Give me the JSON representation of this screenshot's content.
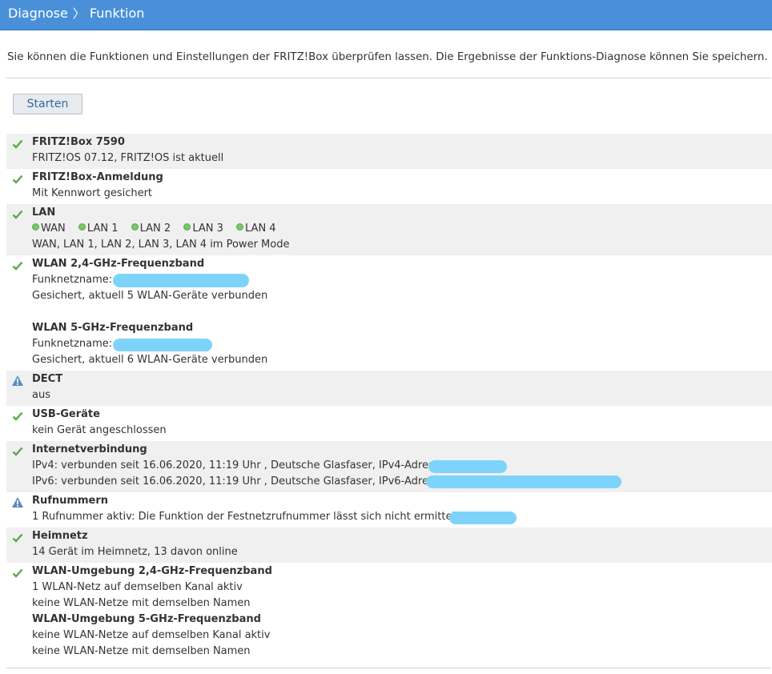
{
  "breadcrumb": {
    "parent": "Diagnose",
    "current": "Funktion"
  },
  "intro": "Sie können die Funktionen und Einstellungen der FRITZ!Box überprüfen lassen. Die Ergebnisse der Funktions-Diagnose können Sie speichern.",
  "start_button": "Starten",
  "results": {
    "fritzbox": {
      "title": "FRITZ!Box 7590",
      "detail": "FRITZ!OS 07.12, FRITZ!OS ist aktuell",
      "status": "ok"
    },
    "login": {
      "title": "FRITZ!Box-Anmeldung",
      "detail": "Mit Kennwort gesichert",
      "status": "ok"
    },
    "lan": {
      "title": "LAN",
      "ports": [
        "WAN",
        "LAN 1",
        "LAN 2",
        "LAN 3",
        "LAN 4"
      ],
      "detail": "WAN, LAN 1, LAN 2, LAN 3, LAN 4 im Power Mode",
      "status": "ok",
      "port_color": "#79c66b"
    },
    "wlan24": {
      "title": "WLAN 2,4-GHz-Frequenzband",
      "name_label": "Funknetzname:",
      "detail": "Gesichert, aktuell 5 WLAN-Geräte verbunden",
      "status": "ok"
    },
    "wlan5": {
      "title": "WLAN 5-GHz-Frequenzband",
      "name_label": "Funknetzname:",
      "detail": "Gesichert, aktuell 6 WLAN-Geräte verbunden"
    },
    "dect": {
      "title": "DECT",
      "detail": "aus",
      "status": "warning"
    },
    "usb": {
      "title": "USB-Geräte",
      "detail": "kein Gerät angeschlossen",
      "status": "ok"
    },
    "internet": {
      "title": "Internetverbindung",
      "ipv4": "IPv4: verbunden seit 16.06.2020, 11:19 Uhr , Deutsche Glasfaser, IPv4-Adresse:",
      "ipv6": "IPv6: verbunden seit 16.06.2020, 11:19 Uhr , Deutsche Glasfaser, IPv6-Adresse:",
      "status": "ok"
    },
    "phone": {
      "title": "Rufnummern",
      "detail": "1 Rufnummer aktiv: Die Funktion der Festnetzrufnummer lässt sich nicht ermitteln.",
      "status": "warning"
    },
    "homenet": {
      "title": "Heimnetz",
      "detail": "14 Gerät im Heimnetz, 13 davon online",
      "status": "ok"
    },
    "env24": {
      "title": "WLAN-Umgebung 2,4-GHz-Frequenzband",
      "line1": "1 WLAN-Netz auf demselben Kanal aktiv",
      "line2": "keine WLAN-Netze mit demselben Namen",
      "status": "ok"
    },
    "env5": {
      "title": "WLAN-Umgebung 5-GHz-Frequenzband",
      "line1": "keine WLAN-Netze auf demselben Kanal aktiv",
      "line2": "keine WLAN-Netze mit demselben Namen"
    }
  },
  "colors": {
    "header_bg": "#4a90d9",
    "ok": "#5aa84a",
    "warning": "#5b8bbf",
    "redaction": "#7ed3fa"
  }
}
